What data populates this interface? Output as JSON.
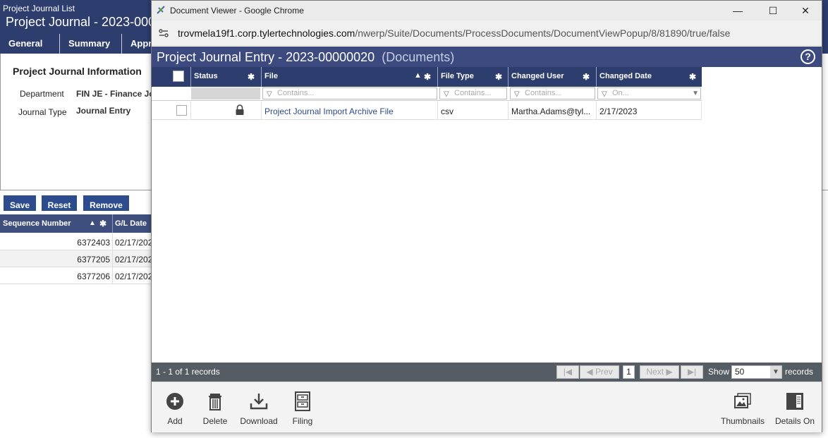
{
  "background_app": {
    "breadcrumb": "Project Journal List",
    "title": "Project Journal - 2023-000",
    "tabs": [
      {
        "label": "General",
        "check": "✓"
      },
      {
        "label": "Summary",
        "check": "✓"
      },
      {
        "label": "Appr"
      }
    ],
    "section_title": "Project Journal Information",
    "fields": {
      "department_label": "Department",
      "department_value": "FIN JE - Finance Jou",
      "journal_type_label": "Journal Type",
      "journal_type_value": "Journal Entry"
    },
    "buttons": {
      "save": "Save",
      "reset": "Reset",
      "remove": "Remove"
    },
    "grid": {
      "columns": [
        "Sequence Number",
        "G/L Date"
      ],
      "rows": [
        {
          "seq": "6372403",
          "date": "02/17/202"
        },
        {
          "seq": "6377205",
          "date": "02/17/202"
        },
        {
          "seq": "6377206",
          "date": "02/17/202"
        }
      ]
    }
  },
  "popup": {
    "window_title": "Document Viewer - Google Chrome",
    "window_controls": {
      "minimize": "—",
      "maximize": "☐",
      "close": "✕"
    },
    "url": {
      "host": "trovmela19f1.corp.tylertechnologies.com",
      "path": "/nwerp/Suite/Documents/ProcessDocuments/DocumentViewPopup/8/81890/true/false"
    },
    "viewer_title": "Project Journal Entry - 2023-00000020",
    "viewer_subtitle": "(Documents)",
    "help": "?",
    "columns": {
      "status": "Status",
      "file": "File",
      "file_type": "File Type",
      "changed_user": "Changed User",
      "changed_date": "Changed Date"
    },
    "filters": {
      "file": "Contains...",
      "file_type": "Contains...",
      "changed_user": "Contains...",
      "changed_date": "On..."
    },
    "rows": [
      {
        "file": "Project Journal Import Archive File",
        "file_type": "csv",
        "changed_user": "Martha.Adams@tyl...",
        "changed_date": "2/17/2023"
      }
    ],
    "pager": {
      "count": "1 - 1 of 1 records",
      "prev": "Prev",
      "next": "Next",
      "page": "1",
      "show_label": "Show",
      "show_value": "50",
      "records_label": "records"
    },
    "toolbar": {
      "add": "Add",
      "delete": "Delete",
      "download": "Download",
      "filing": "Filing",
      "thumbnails": "Thumbnails",
      "details_on": "Details On"
    }
  }
}
